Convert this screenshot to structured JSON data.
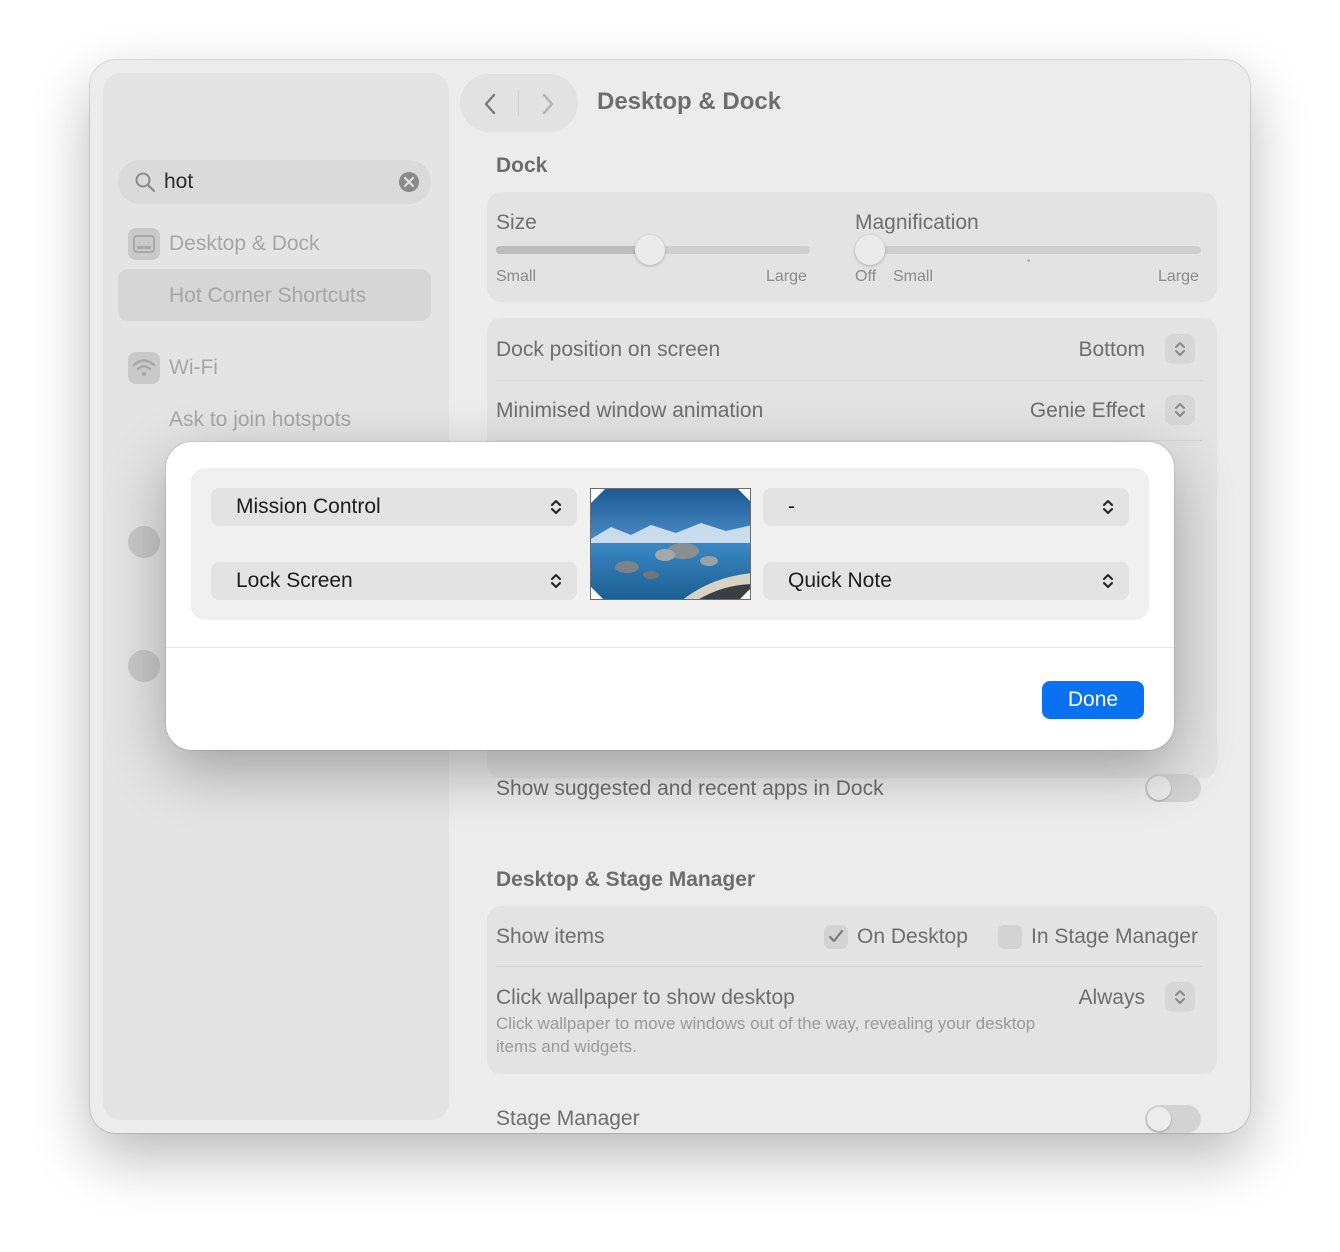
{
  "window": {
    "title": "Desktop & Dock"
  },
  "sidebar": {
    "search": {
      "value": "hot"
    },
    "items": [
      {
        "label": "Desktop & Dock",
        "icon": "desktop-dock-icon"
      },
      {
        "label": "Hot Corner Shortcuts",
        "selected": true
      },
      {
        "label": "Wi-Fi",
        "icon": "wifi-icon"
      },
      {
        "label": "Ask to join hotspots"
      }
    ]
  },
  "dock": {
    "section_title": "Dock",
    "size": {
      "label": "Size",
      "min_label": "Small",
      "max_label": "Large",
      "value": 0.49
    },
    "magnification": {
      "label": "Magnification",
      "off_label": "Off",
      "min_label": "Small",
      "max_label": "Large",
      "value": 0.0
    },
    "rows": [
      {
        "label": "Dock position on screen",
        "value": "Bottom"
      },
      {
        "label": "Minimised window animation",
        "value": "Genie Effect"
      }
    ],
    "suggested_apps": {
      "label": "Show suggested and recent apps in Dock",
      "on": false
    }
  },
  "desktop_stage": {
    "section_title": "Desktop & Stage Manager",
    "show_items": {
      "label": "Show items",
      "on_desktop": "On Desktop",
      "on_desktop_checked": true,
      "in_stage": "In Stage Manager",
      "in_stage_checked": false
    },
    "click_wallpaper": {
      "label": "Click wallpaper to show desktop",
      "value": "Always",
      "description": "Click wallpaper to move windows out of the way, revealing your desktop items and widgets."
    },
    "stage_manager": {
      "label": "Stage Manager",
      "on": false
    }
  },
  "hot_corners": {
    "top_left": "Mission Control",
    "top_right": "-",
    "bottom_left": "Lock Screen",
    "bottom_right": "Quick Note",
    "done_label": "Done"
  },
  "colors": {
    "accent": "#0a72f0",
    "close": "#d9d9d9",
    "minimize": "#fec32e",
    "maximize": "#2ac840"
  }
}
